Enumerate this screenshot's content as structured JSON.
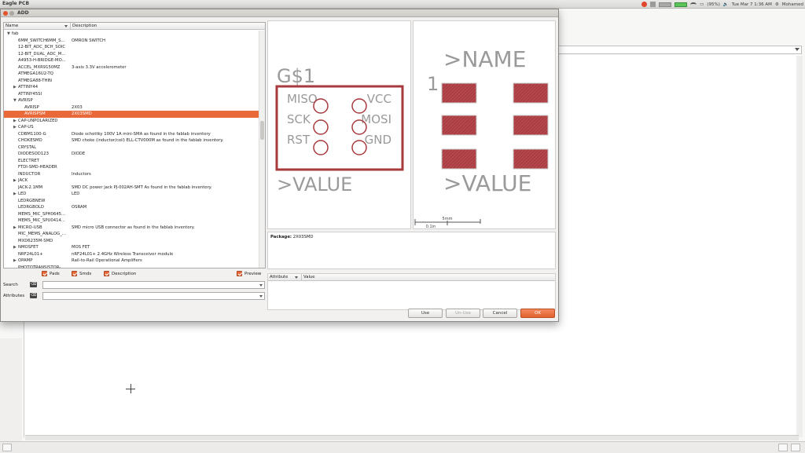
{
  "system": {
    "app_title": "Eagle PCB",
    "battery": "(95%)",
    "clock": "Tue Mar 7  1:36 AM",
    "user": "Mohamed"
  },
  "dialog": {
    "title": "ADD",
    "columns": {
      "name": "Name",
      "description": "Description"
    },
    "rows": [
      {
        "name": "fab",
        "desc": "",
        "level": 0,
        "expander": "▼"
      },
      {
        "name": "6MM_SWITCH6MM_S...",
        "desc": "OMRON SWITCH",
        "level": 1,
        "expander": ""
      },
      {
        "name": "12-BIT_ADC_8CH_SOIC",
        "desc": "",
        "level": 1,
        "expander": ""
      },
      {
        "name": "12-BIT_DUAL_ADC_M...",
        "desc": "",
        "level": 1,
        "expander": ""
      },
      {
        "name": "A4953-H-BRIDGE-MO...",
        "desc": "",
        "level": 1,
        "expander": ""
      },
      {
        "name": "ACCEL_MXR9150MZ",
        "desc": "3-axis 3.3V accelerometer",
        "level": 1,
        "expander": ""
      },
      {
        "name": "ATMEGA16U2-TQ",
        "desc": "",
        "level": 1,
        "expander": ""
      },
      {
        "name": "ATMEGA88-THIN",
        "desc": "",
        "level": 1,
        "expander": ""
      },
      {
        "name": "ATTINY44",
        "desc": "",
        "level": 1,
        "expander": "▶"
      },
      {
        "name": "ATTINY45SI",
        "desc": "",
        "level": 1,
        "expander": ""
      },
      {
        "name": "AVRISP",
        "desc": "",
        "level": 1,
        "expander": "▼"
      },
      {
        "name": "AVRISP",
        "desc": "2X03",
        "level": 2,
        "expander": ""
      },
      {
        "name": "AVRISPSM",
        "desc": "2X03SMD",
        "level": 2,
        "expander": "",
        "selected": true
      },
      {
        "name": "CAP-UNPOLARIZED",
        "desc": "",
        "level": 1,
        "expander": "▶"
      },
      {
        "name": "CAP-US",
        "desc": "",
        "level": 1,
        "expander": "▶"
      },
      {
        "name": "CDBM1100-G",
        "desc": "Diode schottky 100V 1A mini-SMA as found in the fablab inventory",
        "level": 1,
        "expander": ""
      },
      {
        "name": "CHOKESMD",
        "desc": "SMD choke (inductor/coil) ELL-CTV000M as found in the fablab inventory.",
        "level": 1,
        "expander": ""
      },
      {
        "name": "CRYSTAL",
        "desc": "",
        "level": 1,
        "expander": ""
      },
      {
        "name": "DIODESOD123",
        "desc": "DIODE",
        "level": 1,
        "expander": ""
      },
      {
        "name": "ELECTRET",
        "desc": "",
        "level": 1,
        "expander": ""
      },
      {
        "name": "FTDI-SMD-HEADER",
        "desc": "",
        "level": 1,
        "expander": ""
      },
      {
        "name": "INDUCTOR",
        "desc": "Inductors",
        "level": 1,
        "expander": ""
      },
      {
        "name": "JACK",
        "desc": "",
        "level": 1,
        "expander": "▶"
      },
      {
        "name": "JACK-2.1MM",
        "desc": "SMD DC power jack PJ-002AH-SMT As found in the fablab inventory.",
        "level": 1,
        "expander": ""
      },
      {
        "name": "LED",
        "desc": "LED",
        "level": 1,
        "expander": "▶"
      },
      {
        "name": "LEDRGBNEW",
        "desc": "",
        "level": 1,
        "expander": ""
      },
      {
        "name": "LEDRGBOLD",
        "desc": "OSRAM",
        "level": 1,
        "expander": ""
      },
      {
        "name": "MEMS_MIC_SPH0645...",
        "desc": "",
        "level": 1,
        "expander": ""
      },
      {
        "name": "MEMS_MIC_SPU0414...",
        "desc": "",
        "level": 1,
        "expander": ""
      },
      {
        "name": "MICRO-USB",
        "desc": "SMD micro USB connector as found in the fablab inventory.",
        "level": 1,
        "expander": "▶"
      },
      {
        "name": "MIC_MEMS_ANALOG_...",
        "desc": "",
        "level": 1,
        "expander": ""
      },
      {
        "name": "MXD6235M-SMD",
        "desc": "",
        "level": 1,
        "expander": ""
      },
      {
        "name": "NMOSFET",
        "desc": "MOS FET",
        "level": 1,
        "expander": "▶"
      },
      {
        "name": "NRF24L01+",
        "desc": "nRF24L01+ 2.4GHz Wireless Transceiver module",
        "level": 1,
        "expander": ""
      },
      {
        "name": "OPAMP",
        "desc": "Rail-to-Rail Operational Amplifiers",
        "level": 1,
        "expander": "▶"
      },
      {
        "name": "PHOTOTRANSISTOR-...",
        "desc": "",
        "level": 1,
        "expander": ""
      }
    ],
    "filters": {
      "pads": "Pads",
      "smds": "Smds",
      "description": "Description",
      "preview": "Preview"
    },
    "search_label": "Search",
    "attributes_label": "Attributes",
    "symbol": {
      "name": "G$1",
      "pins_left": [
        "MISO",
        "SCK",
        "RST"
      ],
      "pins_right": [
        "VCC",
        "MOSI",
        "GND"
      ],
      "value": ">VALUE"
    },
    "package_preview": {
      "pin_one": "1",
      "name": ">NAME",
      "value": ">VALUE",
      "scale_top": "5mm",
      "scale_bottom": "0.1in"
    },
    "package_info_label": "Package:",
    "package_info_value": "2X03SMD",
    "attr_columns": {
      "attribute": "Attribute",
      "value": "Value"
    },
    "buttons": {
      "use": "Use",
      "unuse": "Un-Use",
      "cancel": "Cancel",
      "ok": "OK"
    }
  },
  "colors": {
    "selection": "#e9693a",
    "schematic_outline": "#a83a3e",
    "pad_fill": "#b5474c"
  }
}
